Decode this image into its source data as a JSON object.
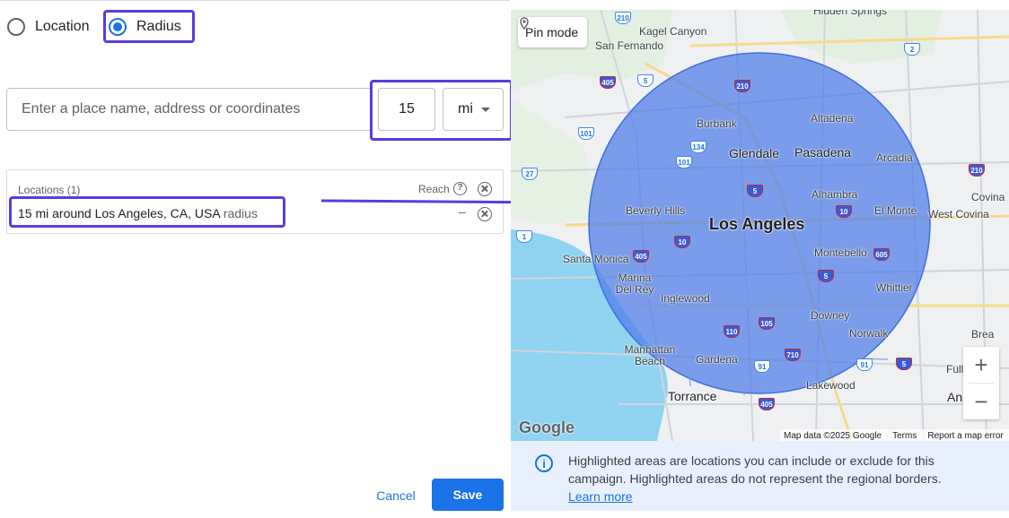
{
  "mode": {
    "location_label": "Location",
    "radius_label": "Radius",
    "selected": "radius"
  },
  "search": {
    "placeholder": "Enter a place name, address or coordinates",
    "value": ""
  },
  "radius": {
    "value": "15",
    "unit": "mi"
  },
  "locations": {
    "header": "Locations (1)",
    "reach_label": "Reach",
    "items": [
      {
        "text": "15 mi around Los Angeles, CA, USA",
        "tag": "radius",
        "reach": "–"
      }
    ]
  },
  "footer": {
    "cancel_label": "Cancel",
    "save_label": "Save"
  },
  "map": {
    "pin_mode_label": "Pin mode",
    "google_logo": "Google",
    "attribution": "Map data ©2025 Google",
    "terms": "Terms",
    "report": "Report a map error",
    "zoom_in": "+",
    "zoom_out": "−",
    "places": {
      "hidden_springs": "Hidden Springs",
      "kagel_canyon": "Kagel Canyon",
      "san_fernando": "San Fernando",
      "burbank": "Burbank",
      "altadena": "Altadena",
      "glendale": "Glendale",
      "pasadena": "Pasadena",
      "arcadia": "Arcadia",
      "beverly_hills": "Beverly Hills",
      "alhambra": "Alhambra",
      "el_monte": "El Monte",
      "west_covina": "West Covina",
      "covina": "Covina",
      "los_angeles": "Los Angeles",
      "santa_monica": "Santa Monica",
      "montebello": "Montebello",
      "marina_del_rey": "Marina Del Rey",
      "inglewood": "Inglewood",
      "whittier": "Whittier",
      "downey": "Downey",
      "norwalk": "Norwalk",
      "brea": "Brea",
      "manhattan_beach": "Manhattan Beach",
      "gardena": "Gardena",
      "fullerton": "Full",
      "torrance": "Torrance",
      "lakewood": "Lakewood",
      "anaheim": "An"
    },
    "colors": {
      "circle_fill": "#4e7ce8",
      "circle_stroke": "#3f6fe0",
      "water": "#8fd3f0",
      "land": "#eef0f2"
    }
  },
  "info": {
    "text": "Highlighted areas are locations you can include or exclude for this campaign. Highlighted areas do not represent the regional borders.",
    "link": "Learn more"
  },
  "colors": {
    "accent": "#1a73e8",
    "highlight_box": "#5b3be0"
  }
}
